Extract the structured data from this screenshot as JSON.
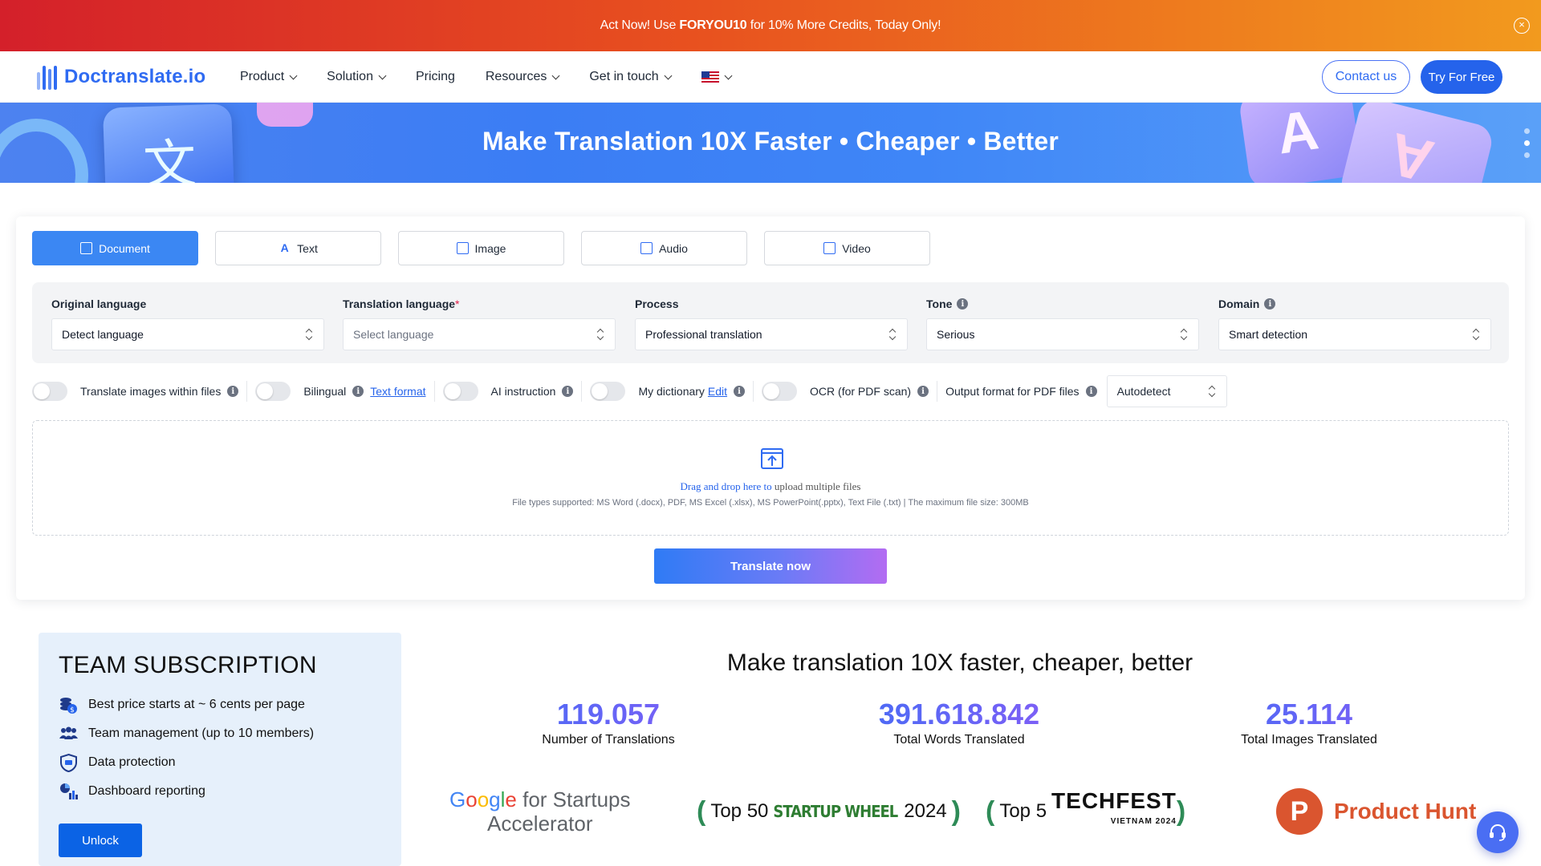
{
  "promo": {
    "text_before": "Act Now! Use ",
    "code": "FORYOU10",
    "text_after": " for 10% More Credits, Today Only!",
    "close_symbol": "×"
  },
  "nav": {
    "logo_text": "Doctranslate.io",
    "menu": [
      {
        "label": "Product",
        "has_dropdown": true
      },
      {
        "label": "Solution",
        "has_dropdown": true
      },
      {
        "label": "Pricing",
        "has_dropdown": false
      },
      {
        "label": "Resources",
        "has_dropdown": true
      },
      {
        "label": "Get in touch",
        "has_dropdown": true
      }
    ],
    "language_flag": "us-flag-icon",
    "contact_label": "Contact us",
    "try_label": "Try For Free"
  },
  "hero": {
    "title": "Make Translation 10X Faster • Cheaper • Better",
    "left_glyph": "文",
    "right_glyph_1": "A",
    "right_glyph_2": "A"
  },
  "tabs": [
    {
      "label": "Document",
      "icon": "document-icon",
      "active": true
    },
    {
      "label": "Text",
      "icon": "text-icon",
      "active": false
    },
    {
      "label": "Image",
      "icon": "image-icon",
      "active": false
    },
    {
      "label": "Audio",
      "icon": "audio-icon",
      "active": false
    },
    {
      "label": "Video",
      "icon": "video-icon",
      "active": false
    }
  ],
  "settings": {
    "original_language": {
      "label": "Original language",
      "value": "Detect language"
    },
    "translation_language": {
      "label": "Translation language",
      "required_mark": "*",
      "placeholder": "Select language"
    },
    "process": {
      "label": "Process",
      "value": "Professional translation"
    },
    "tone": {
      "label": "Tone",
      "value": "Serious"
    },
    "domain": {
      "label": "Domain",
      "value": "Smart detection"
    }
  },
  "options": {
    "translate_images": "Translate images within files",
    "bilingual": "Bilingual",
    "text_format_link": "Text format",
    "ai_instruction": "AI instruction",
    "my_dictionary": "My dictionary",
    "edit_link": "Edit",
    "ocr": "OCR (for PDF scan)",
    "output_format_label": "Output format for PDF files",
    "output_format_value": "Autodetect"
  },
  "upload": {
    "highlight": "Drag and drop here to",
    "rest": " upload multiple files",
    "supported": "File types supported: MS Word (.docx), PDF, MS Excel (.xlsx), MS PowerPoint(.pptx), Text File (.txt) | The maximum file size: 300MB"
  },
  "translate_button": "Translate now",
  "team": {
    "title": "TEAM SUBSCRIPTION",
    "features": [
      {
        "icon": "coins-icon",
        "text": "Best price starts at ~ 6 cents per page"
      },
      {
        "icon": "team-icon",
        "text": "Team management (up to 10 members)"
      },
      {
        "icon": "shield-icon",
        "text": "Data protection"
      },
      {
        "icon": "dashboard-icon",
        "text": "Dashboard reporting"
      }
    ],
    "unlock_label": "Unlock"
  },
  "stats": {
    "title": "Make translation 10X faster, cheaper, better",
    "items": [
      {
        "value": "119.057",
        "label": "Number of Translations"
      },
      {
        "value": "391.618.842",
        "label": "Total Words Translated"
      },
      {
        "value": "25.114",
        "label": "Total Images Translated"
      }
    ]
  },
  "partners": {
    "google_line1_rest": " for Startups",
    "google_line2": "Accelerator",
    "startup_wheel_prefix": "Top 50",
    "startup_wheel_name": "STARTUP WHEEL",
    "startup_wheel_year": "2024",
    "techfest_prefix": "Top 5",
    "techfest_name": "TECHFEST",
    "techfest_sub": "VIETNAM 2024",
    "product_hunt_letter": "P",
    "product_hunt_name": "Product Hunt"
  },
  "colors": {
    "primary": "#2563eb",
    "tab_active": "#3b87f3",
    "promo_start": "#d4202a",
    "promo_end": "#f29a1e",
    "product_hunt": "#da552f"
  }
}
